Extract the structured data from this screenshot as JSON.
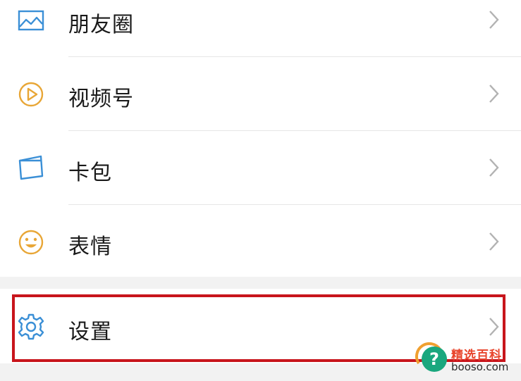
{
  "menu": {
    "items": [
      {
        "label": "朋友圈",
        "icon": "moments-image-icon"
      },
      {
        "label": "视频号",
        "icon": "channels-play-icon"
      },
      {
        "label": "卡包",
        "icon": "card-wallet-icon"
      },
      {
        "label": "表情",
        "icon": "smiley-emoji-icon"
      }
    ],
    "settings": {
      "label": "设置",
      "icon": "gear-icon"
    }
  },
  "watermark": {
    "title": "精选百科",
    "url": "booso.com"
  },
  "colors": {
    "highlight": "#c8151c",
    "icon_blue": "#3a8fd6",
    "icon_orange": "#e8a636",
    "chevron": "#b2b2b2",
    "watermark_badge": "#1aa77e",
    "watermark_title": "#e8452c"
  }
}
